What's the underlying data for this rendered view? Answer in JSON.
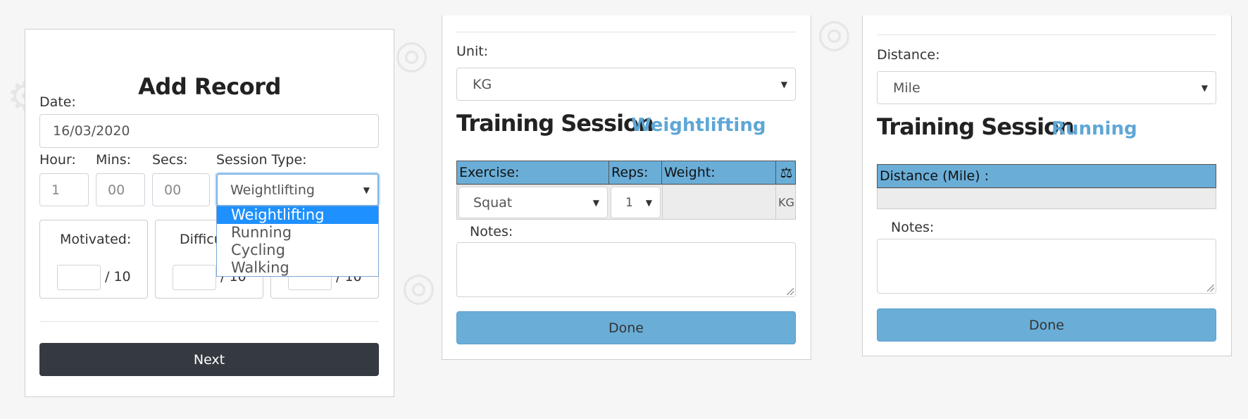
{
  "panel1": {
    "title": "Add Record",
    "date_label": "Date:",
    "date_value": "16/03/2020",
    "hour_label": "Hour:",
    "hour_value": "1",
    "mins_label": "Mins:",
    "mins_placeholder": "00",
    "secs_label": "Secs:",
    "secs_placeholder": "00",
    "session_type_label": "Session Type:",
    "session_type_value": "Weightlifting",
    "session_type_options": [
      "Weightlifting",
      "Running",
      "Cycling",
      "Walking"
    ],
    "ratings": [
      {
        "label": "Motivated:",
        "suffix": "/ 10"
      },
      {
        "label": "Difficu",
        "suffix": "/ 10"
      },
      {
        "label": "",
        "suffix": "/ 10"
      }
    ],
    "next_label": "Next"
  },
  "panel2": {
    "unit_label": "Unit:",
    "unit_value": "KG",
    "session_title": "Training Session",
    "session_type": "Weightlifting",
    "headers": {
      "exercise": "Exercise:",
      "reps": "Reps:",
      "weight": "Weight:",
      "scale_icon": "⚖"
    },
    "row": {
      "exercise": "Squat",
      "reps": "1",
      "unit": "KG"
    },
    "notes_label": "Notes:",
    "done_label": "Done"
  },
  "panel3": {
    "distance_label": "Distance:",
    "distance_value": "Mile",
    "session_title": "Training Session",
    "session_type": "Running",
    "header": "Distance (Mile) :",
    "notes_label": "Notes:",
    "done_label": "Done"
  },
  "colors": {
    "accent": "#6aaed8",
    "dark_button": "#343a40",
    "dropdown_selected": "#1e90ff"
  }
}
